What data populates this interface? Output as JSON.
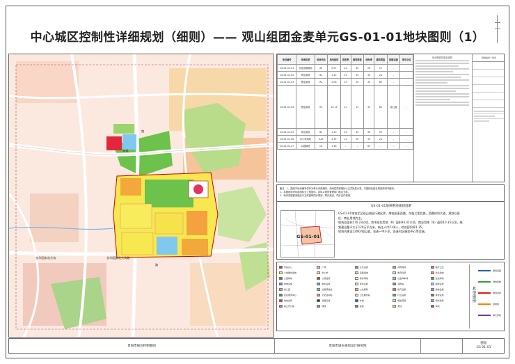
{
  "title": "中心城区控制性详细规划（细则）—— 观山组团金麦单元GS-01-01地块图则（1）",
  "map": {
    "road_labels": [
      "林城",
      "路",
      "路"
    ],
    "place_labels": [
      "金华园街北大沟",
      "金华园路北大沟路",
      "观山组团金麦单元"
    ],
    "zone_label": "GS-01-01"
  },
  "table": {
    "headers": [
      "地块编号",
      "用地性质",
      "用地代码",
      "用地面积",
      "容积率",
      "建筑密度",
      "绿地率",
      "建筑限高",
      "配建设施",
      "停车泊位"
    ],
    "rows": [
      [
        "GS-01-01-01",
        "文化设施用地",
        "A2",
        "0.57",
        "2.5",
        "40",
        "25",
        "15",
        "-",
        "-"
      ],
      [
        "GS-01-01-02",
        "商业用地",
        "B1",
        "1.25",
        "3.0",
        "45",
        "30",
        "24",
        "-",
        "-"
      ],
      [
        "GS-01-01-03",
        "居住用地",
        "R2",
        "2.06",
        "2.5",
        "30",
        "35",
        "80",
        "-",
        "-"
      ],
      [
        "GS-01-01-04",
        "居住用地",
        "R2",
        "15.15",
        "2.5",
        "25",
        "35",
        "80",
        "幼儿园",
        "-"
      ],
      [
        "GS-01-01-05",
        "商业用地",
        "B1",
        "2.43",
        "3.0",
        "40",
        "30",
        "50",
        "-",
        "-"
      ],
      [
        "GS-01-01-06",
        "中小学用地",
        "A33",
        "2.35",
        "1.2",
        "30",
        "35",
        "24",
        "-",
        "-"
      ],
      [
        "GS-01-01-07",
        "公园绿地",
        "G1",
        "3.46",
        "-",
        "-",
        "65",
        "-",
        "-",
        "-"
      ]
    ],
    "note_header": "地块规划控制及说明",
    "mini_header": "控制指标一览表"
  },
  "notes": {
    "n1": "备注：1、图纸中地块编号仅作为单元内部编号，用地性质和指标以正式批复为准，本图则应结合规划说明书使用。",
    "n2": "2、本图则地块控制指标为上限指标，具体以规划管理部门核定为准。",
    "n3": "3、地块内配套设施应与主体建筑同步规划、同步建设、同步交付使用。"
  },
  "guide": {
    "title": "GS-01-01地块用地规划说明",
    "map_label": "GS-01-01",
    "lines": [
      "GS-01-01地块北至观山湖区行政区界，南临金麦西路，东临兰莲北路，西靠阿坝大道，规划以居",
      "住、商业用地为主。",
      "地块总面积170.23公顷，其中居住用地（R）面积93.42公顷，商业用地（B）面积10.35公顷，规",
      "划建设量不大于120万平方米，新住人口2.48人，综合容积率1.35。",
      "地块内建设220KV观山变，金麦一中小学，金麦村区服务中心等设施。"
    ]
  },
  "legend": {
    "items": [
      [
        "#d9362b",
        "行政办公"
      ],
      [
        "#f2b8a0",
        "广场"
      ],
      [
        "#5ba3d9",
        "文化设施"
      ],
      [
        "#8fc464",
        "体育用地"
      ],
      [
        "#e85d9e",
        "医疗卫生"
      ],
      [
        "#f7e94d",
        "二类居住用地"
      ],
      [
        "#ffd966",
        "中小学"
      ],
      [
        "#d0d0d0",
        "道路用地"
      ],
      [
        "#bfe3f5",
        "教育科研"
      ],
      [
        "#ef8f4a",
        "商业用地"
      ],
      [
        "#2e8b57",
        "公园绿地"
      ],
      [
        "#a0522d",
        "公用设施"
      ],
      [
        "#ffffff",
        "防护绿地"
      ],
      [
        "#bbbbbb",
        "社会停车场"
      ],
      [
        "#3fa34d",
        "生态绿地"
      ],
      [
        "#9370db",
        "供电设施"
      ],
      [
        "#6699cc",
        "供水设施"
      ],
      [
        "#ffcc99",
        "商务设施"
      ],
      [
        "#cc6666",
        "消防站"
      ],
      [
        "#99ccff",
        "邮政设施"
      ],
      [
        "#ff9999",
        "幼儿园"
      ],
      [
        "#66cc99",
        "垃圾转运站"
      ],
      [
        "#cccc66",
        "公共厕所"
      ],
      [
        "#ff6666",
        "燃气设施"
      ],
      [
        "#9999cc",
        "通信设施"
      ],
      [
        "#339966",
        "社区服务中心"
      ],
      [
        "#cc9966",
        "文化活动站"
      ],
      [
        "#ffcccc",
        "卫生服务站"
      ],
      [
        "#669966",
        "环卫设施"
      ],
      [
        "#996633",
        "排水设施"
      ],
      [
        "#ff3333",
        "地块边界"
      ],
      [
        "#333333",
        "道路红线"
      ],
      [
        "#0066cc",
        "水域"
      ],
      [
        "#ffe599",
        "规划范围"
      ],
      [
        "#aaaaaa",
        "现状建筑"
      ],
      [
        "#dd7777",
        "禁止开口段"
      ],
      [
        "#77aa77",
        "绿线"
      ],
      [
        "#7777dd",
        "蓝线"
      ],
      [
        "#dddd77",
        "黄线"
      ],
      [
        "#bb5555",
        "紫线"
      ]
    ],
    "side_title": "其他图例",
    "lines": [
      [
        "#1f5fbf",
        "规划道路"
      ],
      [
        "#33a02c",
        "绿地控制"
      ],
      [
        "#e31a1c",
        "规划边界"
      ],
      [
        "#ff7f00",
        "控制线"
      ],
      [
        "#6a3d9a",
        "单元界线"
      ]
    ]
  },
  "footer": {
    "f1": "贵阳市规划控制图则",
    "f2": "贵阳市城乡规划设计研究院",
    "f3": "",
    "f4a": "图号",
    "f4b": "GS-01-01"
  }
}
